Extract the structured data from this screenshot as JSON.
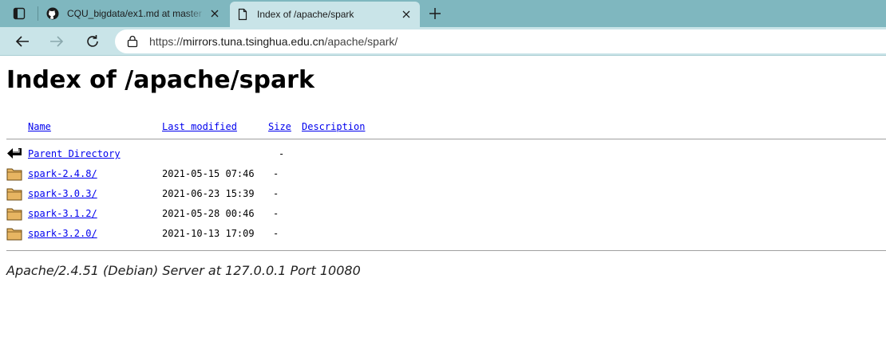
{
  "browser": {
    "tabs": [
      {
        "title": "CQU_bigdata/ex1.md at master · ",
        "active": false,
        "favicon": "github-icon"
      },
      {
        "title": "Index of /apache/spark",
        "active": true,
        "favicon": "page-icon"
      }
    ],
    "url_scheme": "https://",
    "url_host": "mirrors.tuna.tsinghua.edu.cn",
    "url_path": "/apache/spark/"
  },
  "page": {
    "title": "Index of /apache/spark",
    "columns": {
      "name": "Name",
      "last_modified": "Last modified",
      "size": "Size",
      "description": "Description"
    },
    "parent": {
      "label": "Parent Directory",
      "size": "-"
    },
    "entries": [
      {
        "name": "spark-2.4.8/",
        "modified": "2021-05-15 07:46",
        "size": "-"
      },
      {
        "name": "spark-3.0.3/",
        "modified": "2021-06-23 15:39",
        "size": "-"
      },
      {
        "name": "spark-3.1.2/",
        "modified": "2021-05-28 00:46",
        "size": "-"
      },
      {
        "name": "spark-3.2.0/",
        "modified": "2021-10-13 17:09",
        "size": "-"
      }
    ],
    "server_signature": "Apache/2.4.51 (Debian) Server at 127.0.0.1 Port 10080"
  },
  "colors": {
    "tab_bar": "#7fb7bf",
    "toolbar": "#c9e4e8",
    "link": "#0000ee"
  }
}
